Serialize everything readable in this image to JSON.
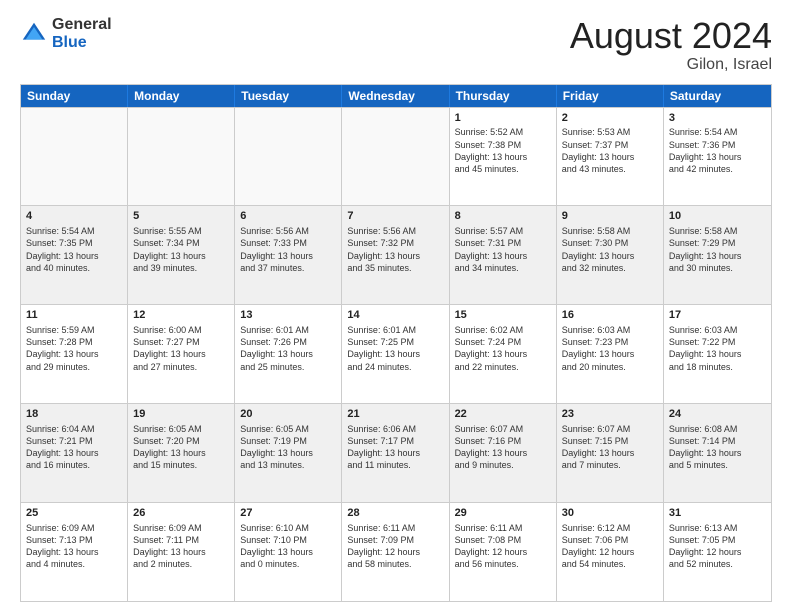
{
  "logo": {
    "general": "General",
    "blue": "Blue"
  },
  "header": {
    "month": "August 2024",
    "location": "Gilon, Israel"
  },
  "weekdays": [
    "Sunday",
    "Monday",
    "Tuesday",
    "Wednesday",
    "Thursday",
    "Friday",
    "Saturday"
  ],
  "weeks": [
    [
      {
        "day": "",
        "empty": true
      },
      {
        "day": "",
        "empty": true
      },
      {
        "day": "",
        "empty": true
      },
      {
        "day": "",
        "empty": true
      },
      {
        "day": "1",
        "info": "Sunrise: 5:52 AM\nSunset: 7:38 PM\nDaylight: 13 hours\nand 45 minutes."
      },
      {
        "day": "2",
        "info": "Sunrise: 5:53 AM\nSunset: 7:37 PM\nDaylight: 13 hours\nand 43 minutes."
      },
      {
        "day": "3",
        "info": "Sunrise: 5:54 AM\nSunset: 7:36 PM\nDaylight: 13 hours\nand 42 minutes."
      }
    ],
    [
      {
        "day": "4",
        "info": "Sunrise: 5:54 AM\nSunset: 7:35 PM\nDaylight: 13 hours\nand 40 minutes."
      },
      {
        "day": "5",
        "info": "Sunrise: 5:55 AM\nSunset: 7:34 PM\nDaylight: 13 hours\nand 39 minutes."
      },
      {
        "day": "6",
        "info": "Sunrise: 5:56 AM\nSunset: 7:33 PM\nDaylight: 13 hours\nand 37 minutes."
      },
      {
        "day": "7",
        "info": "Sunrise: 5:56 AM\nSunset: 7:32 PM\nDaylight: 13 hours\nand 35 minutes."
      },
      {
        "day": "8",
        "info": "Sunrise: 5:57 AM\nSunset: 7:31 PM\nDaylight: 13 hours\nand 34 minutes."
      },
      {
        "day": "9",
        "info": "Sunrise: 5:58 AM\nSunset: 7:30 PM\nDaylight: 13 hours\nand 32 minutes."
      },
      {
        "day": "10",
        "info": "Sunrise: 5:58 AM\nSunset: 7:29 PM\nDaylight: 13 hours\nand 30 minutes."
      }
    ],
    [
      {
        "day": "11",
        "info": "Sunrise: 5:59 AM\nSunset: 7:28 PM\nDaylight: 13 hours\nand 29 minutes."
      },
      {
        "day": "12",
        "info": "Sunrise: 6:00 AM\nSunset: 7:27 PM\nDaylight: 13 hours\nand 27 minutes."
      },
      {
        "day": "13",
        "info": "Sunrise: 6:01 AM\nSunset: 7:26 PM\nDaylight: 13 hours\nand 25 minutes."
      },
      {
        "day": "14",
        "info": "Sunrise: 6:01 AM\nSunset: 7:25 PM\nDaylight: 13 hours\nand 24 minutes."
      },
      {
        "day": "15",
        "info": "Sunrise: 6:02 AM\nSunset: 7:24 PM\nDaylight: 13 hours\nand 22 minutes."
      },
      {
        "day": "16",
        "info": "Sunrise: 6:03 AM\nSunset: 7:23 PM\nDaylight: 13 hours\nand 20 minutes."
      },
      {
        "day": "17",
        "info": "Sunrise: 6:03 AM\nSunset: 7:22 PM\nDaylight: 13 hours\nand 18 minutes."
      }
    ],
    [
      {
        "day": "18",
        "info": "Sunrise: 6:04 AM\nSunset: 7:21 PM\nDaylight: 13 hours\nand 16 minutes."
      },
      {
        "day": "19",
        "info": "Sunrise: 6:05 AM\nSunset: 7:20 PM\nDaylight: 13 hours\nand 15 minutes."
      },
      {
        "day": "20",
        "info": "Sunrise: 6:05 AM\nSunset: 7:19 PM\nDaylight: 13 hours\nand 13 minutes."
      },
      {
        "day": "21",
        "info": "Sunrise: 6:06 AM\nSunset: 7:17 PM\nDaylight: 13 hours\nand 11 minutes."
      },
      {
        "day": "22",
        "info": "Sunrise: 6:07 AM\nSunset: 7:16 PM\nDaylight: 13 hours\nand 9 minutes."
      },
      {
        "day": "23",
        "info": "Sunrise: 6:07 AM\nSunset: 7:15 PM\nDaylight: 13 hours\nand 7 minutes."
      },
      {
        "day": "24",
        "info": "Sunrise: 6:08 AM\nSunset: 7:14 PM\nDaylight: 13 hours\nand 5 minutes."
      }
    ],
    [
      {
        "day": "25",
        "info": "Sunrise: 6:09 AM\nSunset: 7:13 PM\nDaylight: 13 hours\nand 4 minutes."
      },
      {
        "day": "26",
        "info": "Sunrise: 6:09 AM\nSunset: 7:11 PM\nDaylight: 13 hours\nand 2 minutes."
      },
      {
        "day": "27",
        "info": "Sunrise: 6:10 AM\nSunset: 7:10 PM\nDaylight: 13 hours\nand 0 minutes."
      },
      {
        "day": "28",
        "info": "Sunrise: 6:11 AM\nSunset: 7:09 PM\nDaylight: 12 hours\nand 58 minutes."
      },
      {
        "day": "29",
        "info": "Sunrise: 6:11 AM\nSunset: 7:08 PM\nDaylight: 12 hours\nand 56 minutes."
      },
      {
        "day": "30",
        "info": "Sunrise: 6:12 AM\nSunset: 7:06 PM\nDaylight: 12 hours\nand 54 minutes."
      },
      {
        "day": "31",
        "info": "Sunrise: 6:13 AM\nSunset: 7:05 PM\nDaylight: 12 hours\nand 52 minutes."
      }
    ]
  ]
}
